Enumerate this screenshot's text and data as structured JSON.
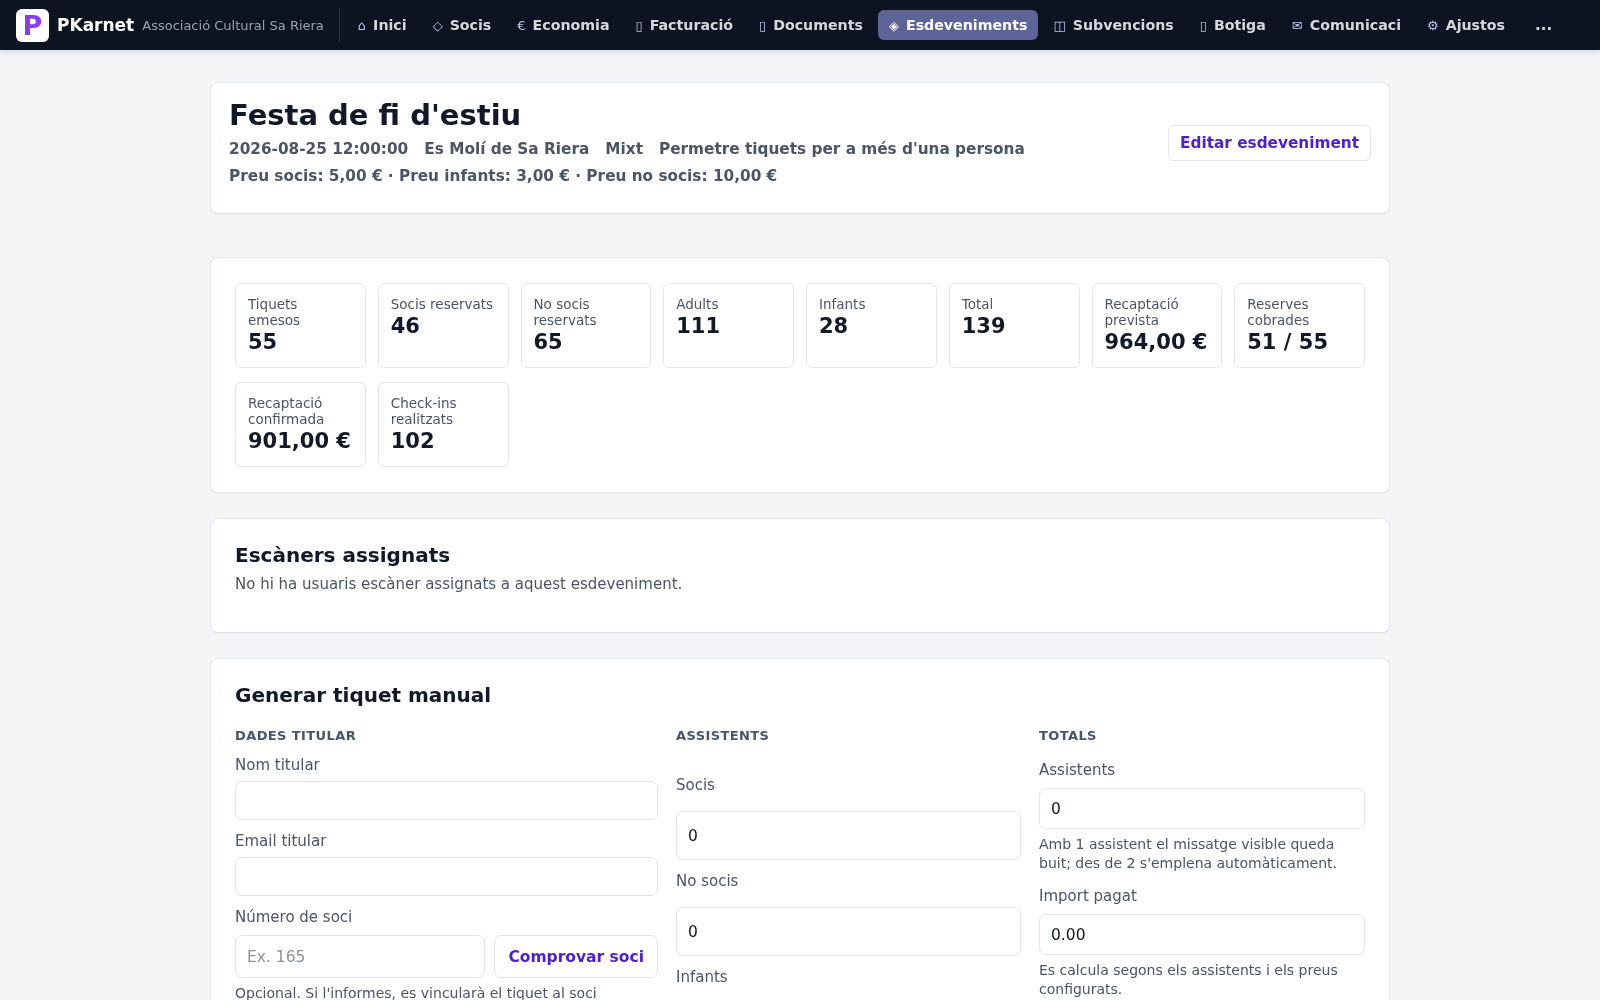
{
  "nav": {
    "logo": "P",
    "brand": "PKarnet",
    "subtitle": "Associació Cultural Sa Riera",
    "items": [
      {
        "icon": "⌂",
        "label": "Inici",
        "selected": false
      },
      {
        "icon": "◇",
        "label": "Socis",
        "selected": false
      },
      {
        "icon": "€",
        "label": "Economia",
        "selected": false
      },
      {
        "icon": "▯",
        "label": "Facturació",
        "selected": false
      },
      {
        "icon": "▯",
        "label": "Documents",
        "selected": false
      },
      {
        "icon": "◈",
        "label": "Esdeveniments",
        "selected": true
      },
      {
        "icon": "◫",
        "label": "Subvencions",
        "selected": false
      },
      {
        "icon": "▯",
        "label": "Botiga",
        "selected": false
      },
      {
        "icon": "✉",
        "label": "Comunicaci",
        "selected": false
      },
      {
        "icon": "⚙",
        "label": "Ajustos",
        "selected": false
      }
    ],
    "more": "..."
  },
  "event": {
    "title": "Festa de fi d'estiu",
    "details": [
      "2026-08-25 12:00:00",
      "Es Molí de Sa Riera",
      "Mixt",
      "Permetre tiquets per a més d'una persona"
    ],
    "prices": "Preu socis: 5,00 € · Preu infants: 3,00 € · Preu no socis: 10,00 €",
    "edit_button": "Editar esdeveniment"
  },
  "stats": [
    {
      "label": "Tiquets emesos",
      "value": "55"
    },
    {
      "label": "Socis reservats",
      "value": "46"
    },
    {
      "label": "No socis reservats",
      "value": "65"
    },
    {
      "label": "Adults",
      "value": "111"
    },
    {
      "label": "Infants",
      "value": "28"
    },
    {
      "label": "Total",
      "value": "139"
    },
    {
      "label": "Recaptació prevista",
      "value": "964,00 €"
    },
    {
      "label": "Reserves cobrades",
      "value": "51 / 55"
    },
    {
      "label": "Recaptació confirmada",
      "value": "901,00 €"
    },
    {
      "label": "Check-ins realitzats",
      "value": "102"
    }
  ],
  "scanners": {
    "title": "Escàners assignats",
    "empty_message": "No hi ha usuaris escàner assignats a aquest esdeveniment."
  },
  "manual_ticket": {
    "title": "Generar tiquet manual",
    "columns": [
      {
        "heading": "DADES TITULAR",
        "fields": [
          {
            "kind": "text",
            "label": "Nom titular"
          },
          {
            "kind": "text",
            "label": "Email titular"
          },
          {
            "kind": "lookup",
            "label": "Número de soci",
            "placeholder": "Ex. 165",
            "button": "Comprovar soci",
            "help": "Opcional. Si l'informes, es vincularà el tiquet al soci"
          }
        ]
      },
      {
        "heading": "ASSISTENTS",
        "fields": [
          {
            "kind": "text",
            "label": "Socis",
            "value": "0"
          },
          {
            "kind": "text",
            "label": "No socis",
            "value": "0"
          },
          {
            "kind": "label",
            "label": "Infants"
          }
        ]
      },
      {
        "heading": "TOTALS",
        "fields": [
          {
            "kind": "text",
            "label": "Assistents",
            "value": "0",
            "help": "Amb 1 assistent el missatge visible queda buit; des de 2 s'emplena automàticament."
          },
          {
            "kind": "text",
            "label": "Import pagat",
            "value": "0.00",
            "help": "Es calcula segons els assistents i els preus configurats."
          }
        ]
      }
    ]
  }
}
